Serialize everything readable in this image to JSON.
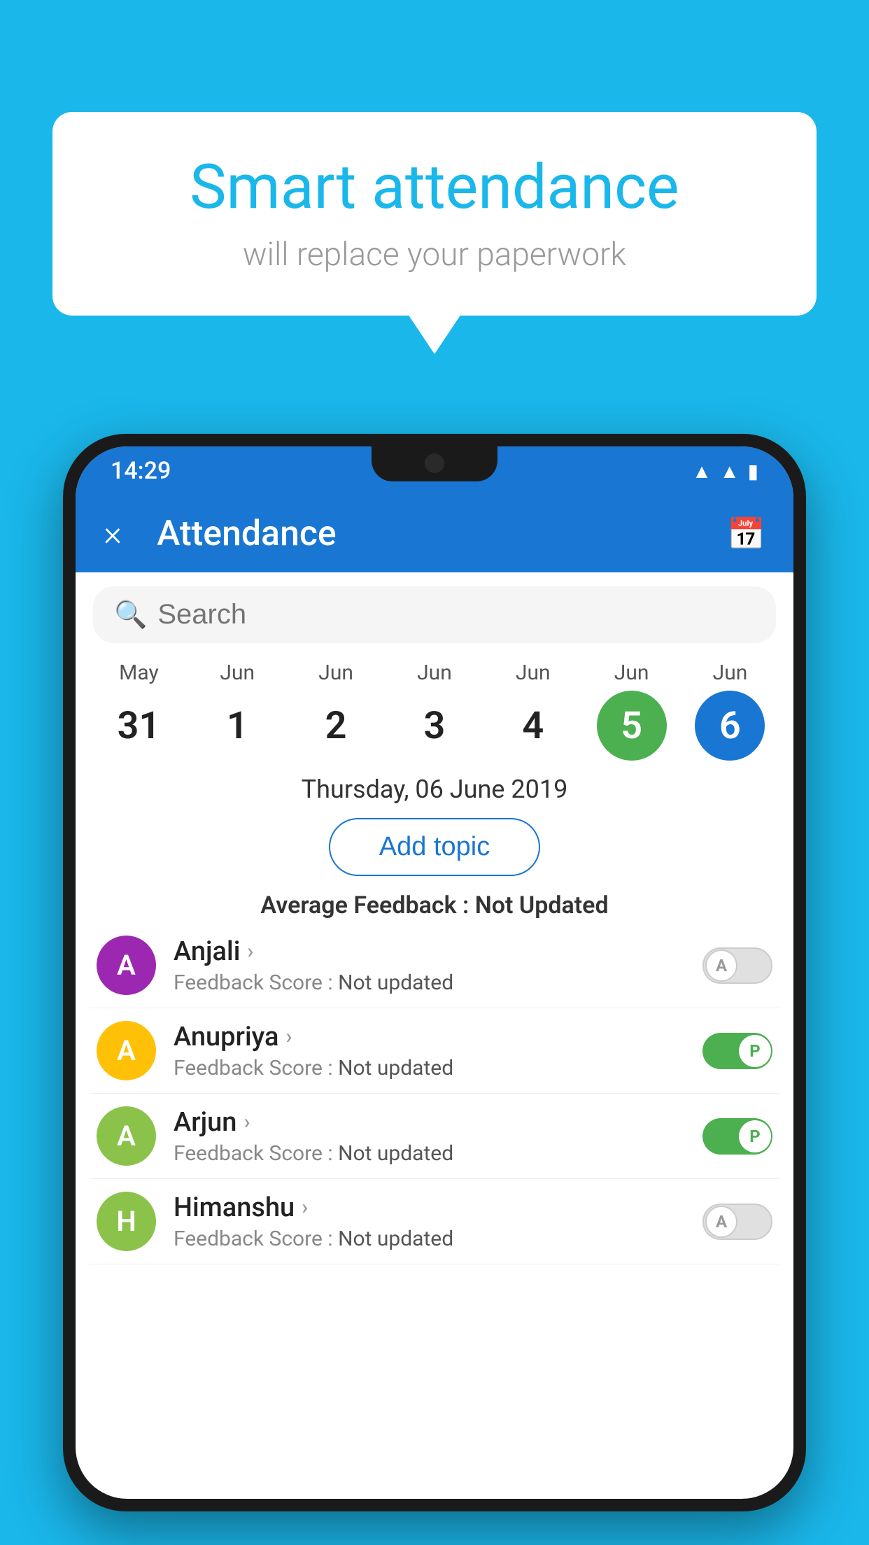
{
  "background_color": "#1ab7ea",
  "bubble": {
    "title": "Smart attendance",
    "subtitle": "will replace your paperwork"
  },
  "status_bar": {
    "time": "14:29",
    "icons": [
      "wifi",
      "signal",
      "battery"
    ]
  },
  "app_bar": {
    "title": "Attendance",
    "close_label": "×",
    "calendar_icon": "🗓"
  },
  "search": {
    "placeholder": "Search"
  },
  "dates": [
    {
      "month": "May",
      "day": "31",
      "state": "normal"
    },
    {
      "month": "Jun",
      "day": "1",
      "state": "normal"
    },
    {
      "month": "Jun",
      "day": "2",
      "state": "normal"
    },
    {
      "month": "Jun",
      "day": "3",
      "state": "normal"
    },
    {
      "month": "Jun",
      "day": "4",
      "state": "normal"
    },
    {
      "month": "Jun",
      "day": "5",
      "state": "today"
    },
    {
      "month": "Jun",
      "day": "6",
      "state": "selected"
    }
  ],
  "selected_date_label": "Thursday, 06 June 2019",
  "add_topic_label": "Add topic",
  "avg_feedback_label": "Average Feedback : ",
  "avg_feedback_value": "Not Updated",
  "students": [
    {
      "name": "Anjali",
      "initial": "A",
      "avatar_color": "#9c27b0",
      "feedback": "Feedback Score : Not updated",
      "toggle": "off",
      "toggle_label": "A"
    },
    {
      "name": "Anupriya",
      "initial": "A",
      "avatar_color": "#ffc107",
      "feedback": "Feedback Score : Not updated",
      "toggle": "on",
      "toggle_label": "P"
    },
    {
      "name": "Arjun",
      "initial": "A",
      "avatar_color": "#8bc34a",
      "feedback": "Feedback Score : Not updated",
      "toggle": "on",
      "toggle_label": "P"
    },
    {
      "name": "Himanshu",
      "initial": "H",
      "avatar_color": "#8bc34a",
      "feedback": "Feedback Score : Not updated",
      "toggle": "off",
      "toggle_label": "A"
    }
  ]
}
